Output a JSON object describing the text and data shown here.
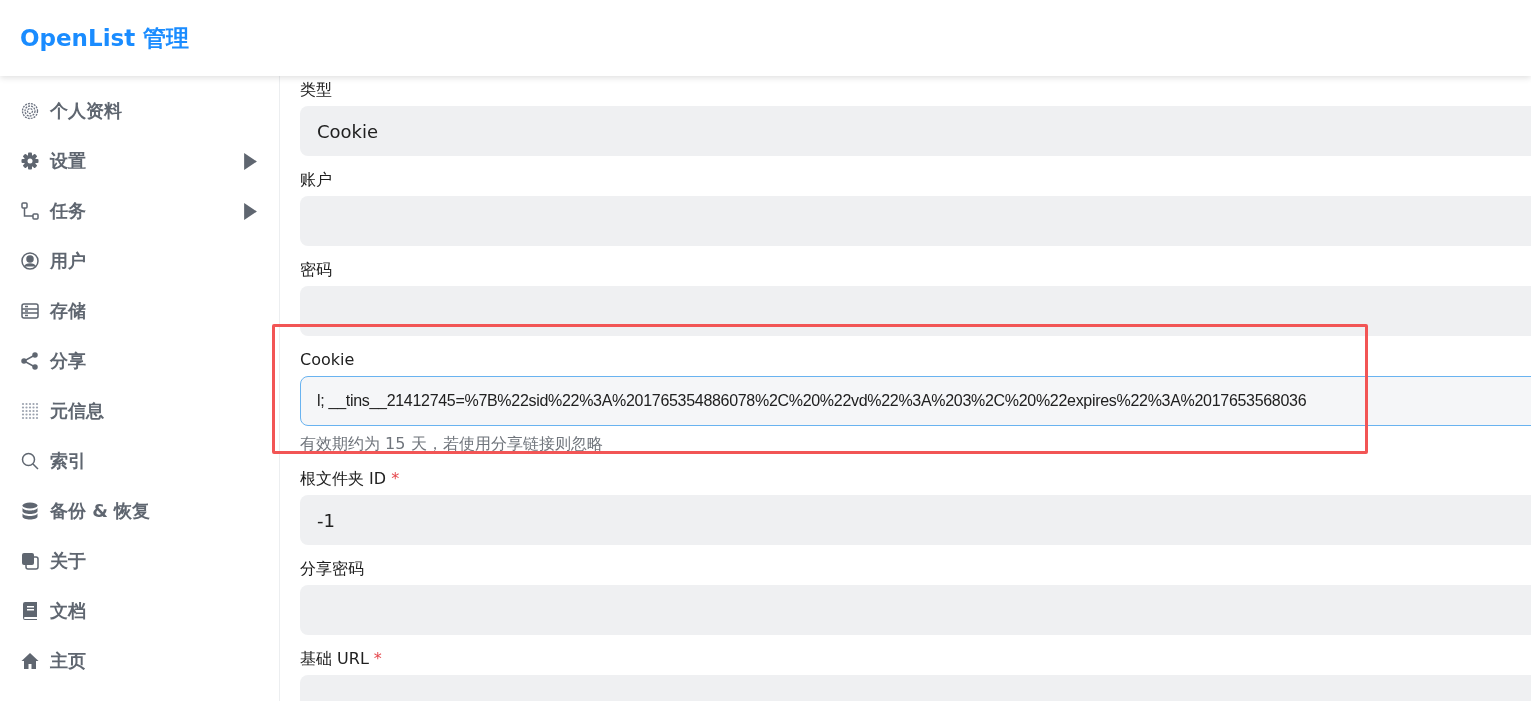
{
  "header": {
    "title": "OpenList 管理"
  },
  "sidebar": {
    "items": [
      {
        "kind": "fingerprint",
        "label": "个人资料",
        "expandable": false
      },
      {
        "kind": "gear",
        "label": "设置",
        "expandable": true
      },
      {
        "kind": "flow",
        "label": "任务",
        "expandable": true
      },
      {
        "kind": "user",
        "label": "用户",
        "expandable": false
      },
      {
        "kind": "storage",
        "label": "存储",
        "expandable": false
      },
      {
        "kind": "share",
        "label": "分享",
        "expandable": false
      },
      {
        "kind": "dots",
        "label": "元信息",
        "expandable": false
      },
      {
        "kind": "search",
        "label": "索引",
        "expandable": false
      },
      {
        "kind": "database",
        "label": "备份 & 恢复",
        "expandable": false
      },
      {
        "kind": "copy",
        "label": "关于",
        "expandable": false
      },
      {
        "kind": "book",
        "label": "文档",
        "expandable": false
      },
      {
        "kind": "home",
        "label": "主页",
        "expandable": false
      }
    ]
  },
  "form": {
    "fields": [
      {
        "label": "类型",
        "value": "Cookie",
        "focused": false,
        "annotated": false
      },
      {
        "label": "账户",
        "focused": false,
        "annotated": false
      },
      {
        "label": "密码",
        "focused": false,
        "annotated": false
      },
      {
        "label": "Cookie",
        "value": "l; __tins__21412745=%7B%22sid%22%3A%201765354886078%2C%20%22vd%22%3A%203%2C%20%22expires%22%3A%2017653568036",
        "help": "有效期约为 15 天，若使用分享链接则忽略",
        "focused": true,
        "annotated": true
      },
      {
        "label": "根文件夹 ID",
        "required_mark": "*",
        "value": "-1",
        "focused": false,
        "annotated": false
      },
      {
        "label": "分享密码",
        "focused": false,
        "annotated": false
      },
      {
        "label": "基础 URL",
        "required_mark": "*",
        "focused": false,
        "annotated": false
      }
    ]
  }
}
